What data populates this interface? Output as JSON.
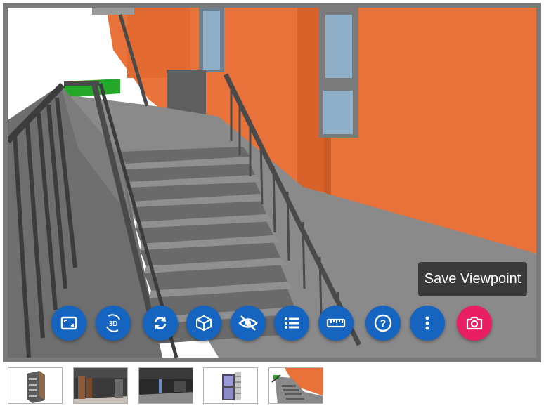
{
  "toolbar": {
    "buttons": [
      {
        "name": "fullscreen",
        "icon": "fullscreen-icon"
      },
      {
        "name": "3d-view",
        "icon": "3d-rotate-icon",
        "text": "3D"
      },
      {
        "name": "reset",
        "icon": "sync-icon"
      },
      {
        "name": "model",
        "icon": "cube-icon"
      },
      {
        "name": "hide",
        "icon": "eye-off-icon"
      },
      {
        "name": "list",
        "icon": "list-icon"
      },
      {
        "name": "measure",
        "icon": "ruler-icon"
      },
      {
        "name": "help",
        "icon": "help-icon",
        "text": "?"
      },
      {
        "name": "more",
        "icon": "more-vert-icon"
      },
      {
        "name": "save-viewpoint",
        "icon": "camera-icon"
      }
    ],
    "colors": {
      "primary": "#1565c0",
      "camera": "#e91e63"
    }
  },
  "tooltip": {
    "text": "Save Viewpoint"
  },
  "thumbnails": [
    {
      "name": "viewpoint-1",
      "icon": "building-exterior"
    },
    {
      "name": "viewpoint-2",
      "icon": "interior-corridor"
    },
    {
      "name": "viewpoint-3",
      "icon": "interior-room"
    },
    {
      "name": "viewpoint-4",
      "icon": "window-detail"
    },
    {
      "name": "viewpoint-5",
      "icon": "staircase-view"
    }
  ]
}
